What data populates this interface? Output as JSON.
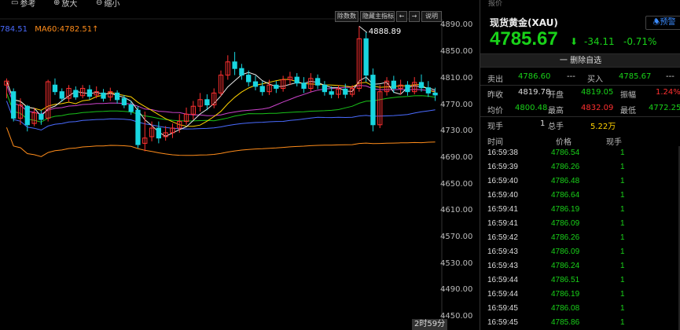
{
  "toolbar": {
    "items": [
      {
        "label": "参考",
        "icon": "ruler-icon"
      },
      {
        "label": "放大",
        "icon": "zoom-in-icon"
      },
      {
        "label": "缩小",
        "icon": "zoom-out-icon"
      }
    ],
    "chips": [
      "除数数",
      "隐藏主指标",
      "←",
      "→",
      "说明"
    ]
  },
  "ma_row": [
    {
      "label": "784.51",
      "color": "#4a6bff"
    },
    {
      "label": "MA60:4782.51↑",
      "color": "#ff8c1a"
    }
  ],
  "chart_data": {
    "type": "candlestick",
    "price_ticks": [
      "4890.00",
      "4850.00",
      "4810.00",
      "4770.00",
      "4730.00",
      "4690.00",
      "4650.00",
      "4610.00",
      "4570.00",
      "4530.00",
      "4490.00",
      "4450.00"
    ],
    "ylim": [
      4430,
      4900
    ],
    "peak_label": "4888.89",
    "peak_value": 4888.89,
    "time_label": "2时59分",
    "candles": [
      [
        4800,
        4806,
        4780,
        4810
      ],
      [
        4790,
        4750,
        4745,
        4795
      ],
      [
        4750,
        4770,
        4740,
        4780
      ],
      [
        4768,
        4740,
        4730,
        4770
      ],
      [
        4742,
        4758,
        4738,
        4765
      ],
      [
        4756,
        4748,
        4740,
        4762
      ],
      [
        4750,
        4805,
        4745,
        4808
      ],
      [
        4800,
        4790,
        4785,
        4810
      ],
      [
        4790,
        4780,
        4775,
        4795
      ],
      [
        4780,
        4795,
        4775,
        4800
      ],
      [
        4792,
        4782,
        4778,
        4798
      ],
      [
        4784,
        4795,
        4780,
        4800
      ],
      [
        4793,
        4783,
        4778,
        4800
      ],
      [
        4785,
        4790,
        4780,
        4798
      ],
      [
        4788,
        4780,
        4775,
        4794
      ],
      [
        4782,
        4790,
        4776,
        4796
      ],
      [
        4788,
        4778,
        4772,
        4792
      ],
      [
        4780,
        4770,
        4765,
        4785
      ],
      [
        4770,
        4760,
        4755,
        4776
      ],
      [
        4762,
        4710,
        4705,
        4768
      ],
      [
        4712,
        4720,
        4700,
        4760
      ],
      [
        4722,
        4735,
        4715,
        4745
      ],
      [
        4735,
        4720,
        4712,
        4745
      ],
      [
        4722,
        4728,
        4716,
        4738
      ],
      [
        4728,
        4735,
        4720,
        4742
      ],
      [
        4735,
        4745,
        4728,
        4756
      ],
      [
        4745,
        4756,
        4740,
        4766
      ],
      [
        4756,
        4768,
        4748,
        4776
      ],
      [
        4768,
        4778,
        4760,
        4788
      ],
      [
        4778,
        4770,
        4762,
        4786
      ],
      [
        4770,
        4788,
        4765,
        4795
      ],
      [
        4788,
        4815,
        4783,
        4822
      ],
      [
        4815,
        4835,
        4808,
        4845
      ],
      [
        4835,
        4825,
        4815,
        4850
      ],
      [
        4825,
        4815,
        4808,
        4832
      ],
      [
        4815,
        4805,
        4798,
        4822
      ],
      [
        4805,
        4798,
        4792,
        4814
      ],
      [
        4798,
        4790,
        4784,
        4806
      ],
      [
        4790,
        4800,
        4785,
        4808
      ],
      [
        4800,
        4795,
        4788,
        4806
      ],
      [
        4795,
        4808,
        4790,
        4814
      ],
      [
        4808,
        4812,
        4800,
        4820
      ],
      [
        4812,
        4803,
        4798,
        4818
      ],
      [
        4803,
        4795,
        4788,
        4812
      ],
      [
        4795,
        4810,
        4790,
        4818
      ],
      [
        4810,
        4800,
        4794,
        4816
      ],
      [
        4800,
        4790,
        4784,
        4806
      ],
      [
        4790,
        4786,
        4780,
        4798
      ],
      [
        4786,
        4794,
        4780,
        4800
      ],
      [
        4794,
        4786,
        4780,
        4802
      ],
      [
        4786,
        4795,
        4782,
        4800
      ],
      [
        4795,
        4870,
        4790,
        4889
      ],
      [
        4870,
        4815,
        4805,
        4880
      ],
      [
        4815,
        4740,
        4730,
        4825
      ],
      [
        4740,
        4790,
        4735,
        4800
      ],
      [
        4790,
        4806,
        4784,
        4812
      ],
      [
        4806,
        4795,
        4788,
        4814
      ],
      [
        4795,
        4800,
        4786,
        4808
      ],
      [
        4800,
        4790,
        4784,
        4806
      ],
      [
        4790,
        4804,
        4786,
        4812
      ],
      [
        4804,
        4796,
        4790,
        4816
      ],
      [
        4796,
        4788,
        4782,
        4806
      ],
      [
        4788,
        4785,
        4776,
        4796
      ]
    ]
  },
  "quote": {
    "top_label": "报价",
    "title": "现货黄金(XAU)",
    "alert_label": "预警",
    "price": "4785.67",
    "change": "-34.11",
    "change_pct": "-0.71%",
    "remove_fav": "一 删除自选",
    "rows": [
      {
        "l1": "卖出",
        "v1": "4786.60",
        "d1": "---",
        "l2": "买入",
        "v2": "4785.67",
        "d2": "---",
        "v1c": "g",
        "v2c": "g"
      },
      {
        "l1": "昨收",
        "v1": "4819.78",
        "l2": "开盘",
        "v2": "4819.05",
        "l3": "振幅",
        "v3": "1.24%",
        "v1c": "w",
        "v2c": "g",
        "v3c": "r"
      },
      {
        "l1": "均价",
        "v1": "4800.48",
        "l2": "最高",
        "v2": "4832.09",
        "l3": "最低",
        "v3": "4772.25",
        "v1c": "g",
        "v2c": "r",
        "v3c": "g"
      },
      {
        "l1": "现手",
        "v1": "1",
        "l2": "总手",
        "v2": "5.22万",
        "v1c": "w",
        "v2c": "y"
      }
    ],
    "trade_headers": {
      "time": "时间",
      "price": "价格",
      "vol": "现手"
    },
    "trades": [
      {
        "time": "16:59:38",
        "price": "4786.54",
        "vol": "1"
      },
      {
        "time": "16:59:39",
        "price": "4786.26",
        "vol": "1"
      },
      {
        "time": "16:59:40",
        "price": "4786.48",
        "vol": "1"
      },
      {
        "time": "16:59:40",
        "price": "4786.64",
        "vol": "1"
      },
      {
        "time": "16:59:41",
        "price": "4786.19",
        "vol": "1"
      },
      {
        "time": "16:59:41",
        "price": "4786.09",
        "vol": "1"
      },
      {
        "time": "16:59:42",
        "price": "4786.26",
        "vol": "1"
      },
      {
        "time": "16:59:43",
        "price": "4786.09",
        "vol": "1"
      },
      {
        "time": "16:59:43",
        "price": "4786.24",
        "vol": "1"
      },
      {
        "time": "16:59:44",
        "price": "4786.51",
        "vol": "1"
      },
      {
        "time": "16:59:44",
        "price": "4786.19",
        "vol": "1"
      },
      {
        "time": "16:59:45",
        "price": "4786.08",
        "vol": "1"
      },
      {
        "time": "16:59:45",
        "price": "4785.86",
        "vol": "1"
      }
    ]
  },
  "colors": {
    "up": "#ff3030",
    "down": "#19d6e0",
    "ma5": "#e8e8e8",
    "ma10": "#ffd200",
    "ma20": "#cc44cc",
    "ma30": "#19c219",
    "ma40": "#4a6bff",
    "ma60": "#ff8c1a"
  }
}
